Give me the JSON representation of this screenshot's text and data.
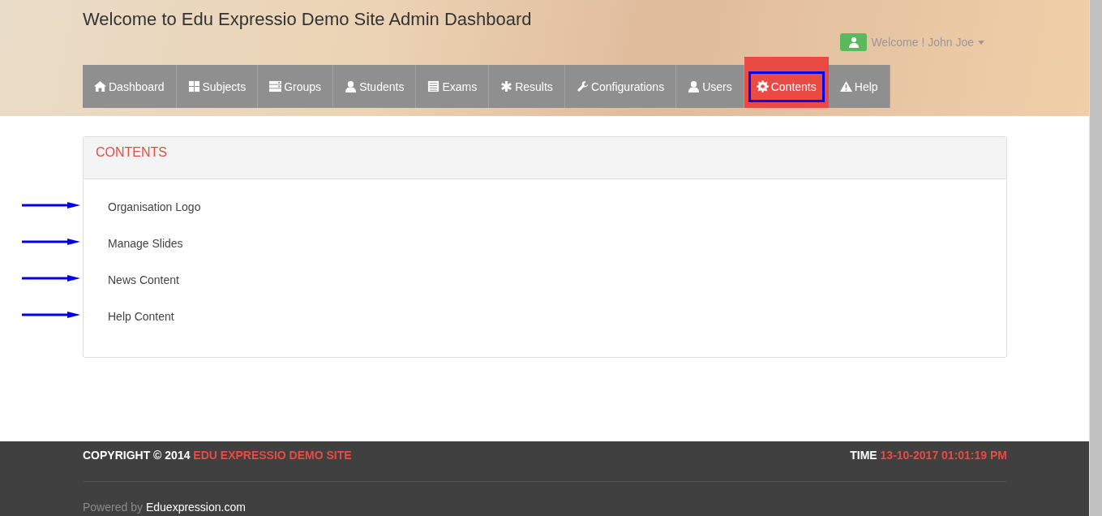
{
  "header": {
    "title": "Welcome to Edu Expressio Demo Site Admin Dashboard",
    "user_menu": {
      "label": "Welcome ! John Joe"
    }
  },
  "nav": [
    {
      "label": "Dashboard",
      "selected": false,
      "outlined": false
    },
    {
      "label": "Subjects",
      "selected": false,
      "outlined": false
    },
    {
      "label": "Groups",
      "selected": false,
      "outlined": false
    },
    {
      "label": "Students",
      "selected": false,
      "outlined": false
    },
    {
      "label": "Exams",
      "selected": false,
      "outlined": false
    },
    {
      "label": "Results",
      "selected": false,
      "outlined": false
    },
    {
      "label": "Configurations",
      "selected": false,
      "outlined": false
    },
    {
      "label": "Users",
      "selected": false,
      "outlined": false
    },
    {
      "label": "Contents",
      "selected": true,
      "outlined": true
    },
    {
      "label": "Help",
      "selected": false,
      "outlined": false
    }
  ],
  "panel": {
    "title": "CONTENTS",
    "items": [
      {
        "label": "Organisation Logo",
        "arrow": true
      },
      {
        "label": "Manage Slides",
        "arrow": true
      },
      {
        "label": "News Content",
        "arrow": true
      },
      {
        "label": "Help Content",
        "arrow": true
      }
    ]
  },
  "footer": {
    "copyright": "COPYRIGHT © 2014",
    "site": "EDU EXPRESSIO DEMO SITE",
    "time_label": "TIME",
    "time": "13-10-2017 01:01:19 PM",
    "powered_label": "Powered by",
    "powered_link": "Eduexpression.com"
  }
}
